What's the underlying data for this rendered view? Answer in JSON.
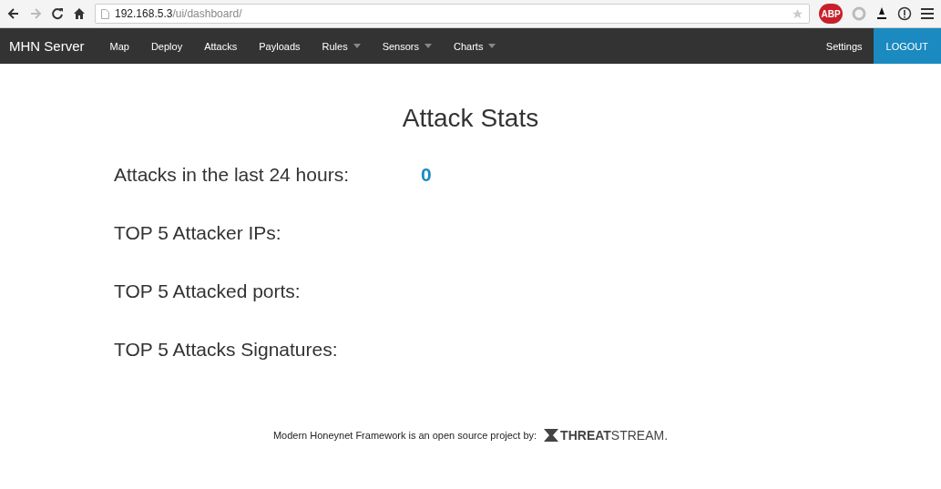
{
  "browser": {
    "url_host": "192.168.5.3",
    "url_path": "/ui/dashboard/",
    "extension_badge": "ABP"
  },
  "navbar": {
    "brand": "MHN Server",
    "items": [
      {
        "label": "Map",
        "dropdown": false
      },
      {
        "label": "Deploy",
        "dropdown": false
      },
      {
        "label": "Attacks",
        "dropdown": false
      },
      {
        "label": "Payloads",
        "dropdown": false
      },
      {
        "label": "Rules",
        "dropdown": true
      },
      {
        "label": "Sensors",
        "dropdown": true
      },
      {
        "label": "Charts",
        "dropdown": true
      }
    ],
    "right": [
      {
        "label": "Settings",
        "kind": "link"
      },
      {
        "label": "LOGOUT",
        "kind": "primary"
      }
    ]
  },
  "title": "Attack Stats",
  "stats": [
    {
      "label": "Attacks in the last 24 hours:",
      "value": "0"
    },
    {
      "label": "TOP 5 Attacker IPs:"
    },
    {
      "label": "TOP 5 Attacked ports:"
    },
    {
      "label": "TOP 5 Attacks Signatures:"
    }
  ],
  "footer": {
    "text": "Modern Honeynet Framework is an open source project by:",
    "logo": "**THREAT**STREAM."
  }
}
